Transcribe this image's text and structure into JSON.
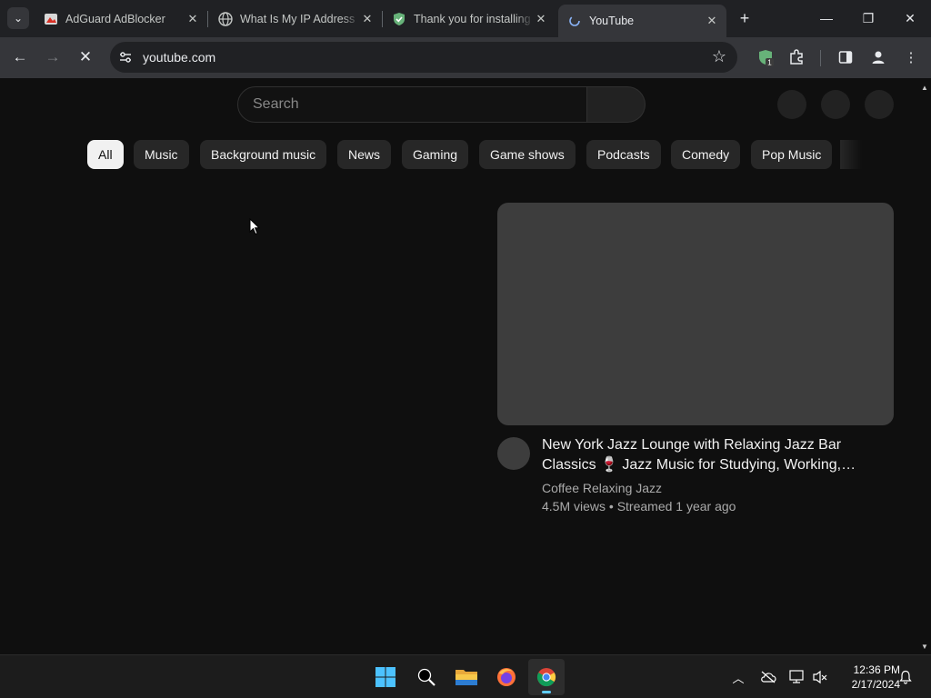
{
  "browser": {
    "tab_menu_icon": "chevron-down-icon",
    "tabs": [
      {
        "title": "AdGuard AdBlocker",
        "icon": "adguard-icon"
      },
      {
        "title": "What Is My IP Address",
        "icon": "globe-icon"
      },
      {
        "title": "Thank you for installing",
        "icon": "shield-check-icon"
      },
      {
        "title": "YouTube",
        "icon": "loading-icon",
        "active": true
      }
    ],
    "new_tab_icon": "plus-icon",
    "address": "youtube.com",
    "extension_badge": "1"
  },
  "youtube": {
    "search_placeholder": "Search",
    "chips": [
      "All",
      "Music",
      "Background music",
      "News",
      "Gaming",
      "Game shows",
      "Podcasts",
      "Comedy",
      "Pop Music"
    ],
    "active_chip": "All",
    "video": {
      "title": "New York Jazz Lounge with Relaxing Jazz Bar Classics 🍷 Jazz Music for Studying, Working, Relaxing",
      "channel": "Coffee Relaxing Jazz",
      "meta": "4.5M views • Streamed 1 year ago"
    }
  },
  "taskbar": {
    "time": "12:36 PM",
    "date": "2/17/2024"
  },
  "colors": {
    "page_bg": "#0f0f0f",
    "chrome_frame": "#202124",
    "chrome_toolbar": "#35363a",
    "chip_bg": "#272727",
    "active_chip_bg": "#f1f1f1",
    "taskbar_bg": "#1c1c1c"
  }
}
